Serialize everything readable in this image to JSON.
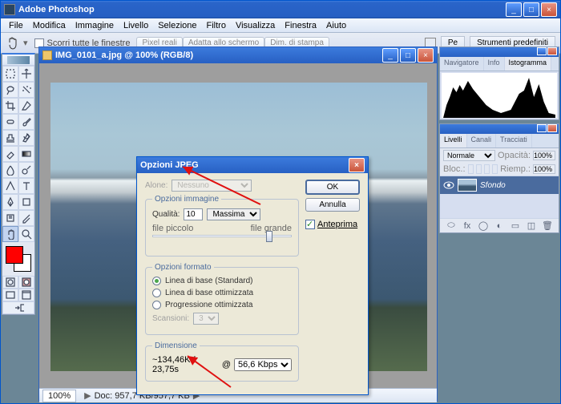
{
  "app": {
    "title": "Adobe Photoshop",
    "menus": [
      "File",
      "Modifica",
      "Immagine",
      "Livello",
      "Selezione",
      "Filtro",
      "Visualizza",
      "Finestra",
      "Aiuto"
    ]
  },
  "optionsbar": {
    "scroll_label": "Scorri tutte le finestre",
    "btn1": "Pixel reali",
    "btn2": "Adatta allo schermo",
    "btn3": "Dim. di stampa",
    "pe_tab": "Pe",
    "presets_tab": "Strumenti predefiniti"
  },
  "doc": {
    "title": "IMG_0101_a.jpg @ 100% (RGB/8)",
    "zoom": "100%",
    "status": "Doc: 957,7 KB/957,7 KB"
  },
  "histo_panel": {
    "tabs": [
      "Navigatore",
      "Info",
      "Istogramma"
    ]
  },
  "layers_panel": {
    "tabs": [
      "Livelli",
      "Canali",
      "Tracciati"
    ],
    "blend": "Normale",
    "opacity_label": "Opacità:",
    "opacity": "100%",
    "lock_label": "Bloc.:",
    "fill_label": "Riemp.:",
    "fill": "100%",
    "layer_name": "Sfondo"
  },
  "jpeg": {
    "title": "Opzioni JPEG",
    "matte_label": "Alone:",
    "matte_value": "Nessuno",
    "group_image": "Opzioni immagine",
    "quality_label": "Qualità:",
    "quality_value": "10",
    "quality_preset": "Massima",
    "small_label": "file piccolo",
    "big_label": "file grande",
    "group_format": "Opzioni formato",
    "fmt1": "Linea di base (Standard)",
    "fmt2": "Linea di base ottimizzata",
    "fmt3": "Progressione ottimizzata",
    "scans_label": "Scansioni:",
    "scans_value": "3",
    "group_size": "Dimensione",
    "size_value": "~134,46K / 23,75s",
    "speed": "56,6 Kbps",
    "ok": "OK",
    "cancel": "Annulla",
    "preview": "Anteprima"
  }
}
